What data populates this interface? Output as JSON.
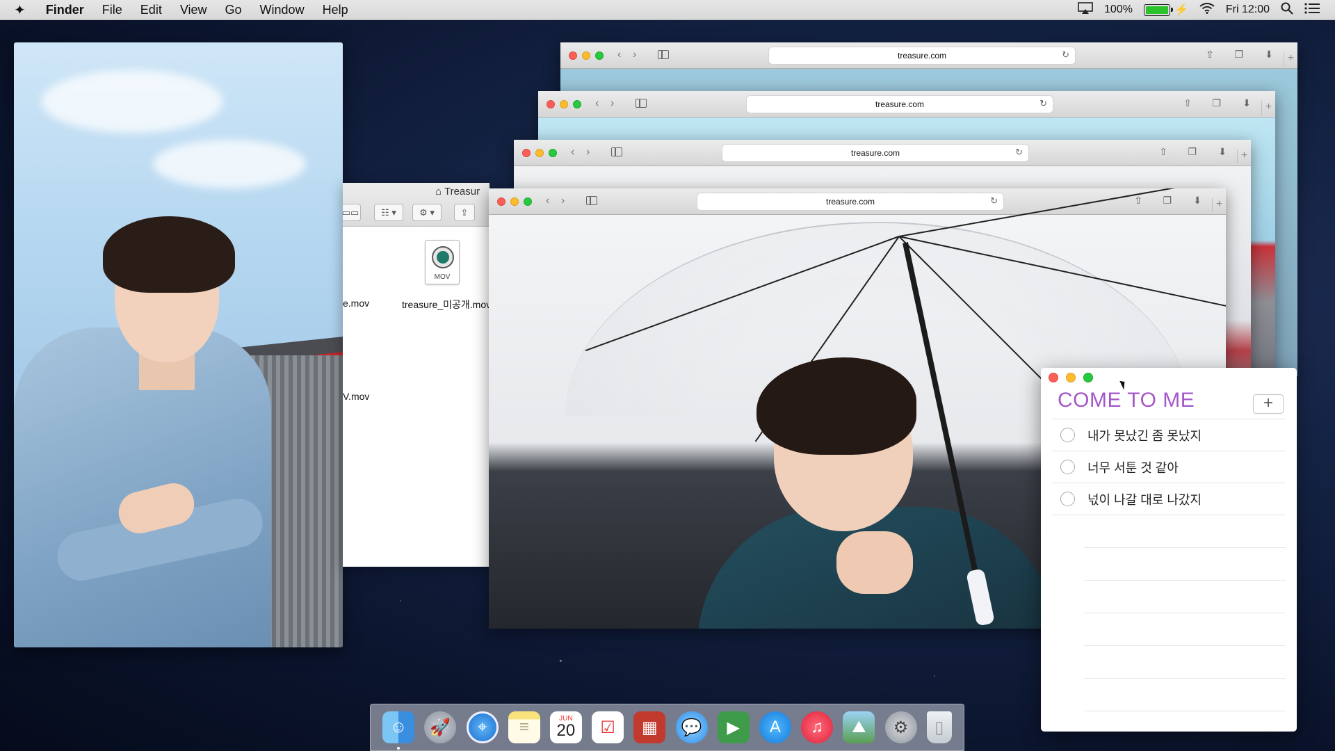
{
  "menubar": {
    "apple": "✦",
    "app": "Finder",
    "menus": [
      "File",
      "Edit",
      "View",
      "Go",
      "Window",
      "Help"
    ],
    "battery_pct": "100%",
    "battery_level": 1.0,
    "clock": "Fri 12:00"
  },
  "finder": {
    "title": "Treasur",
    "files": [
      {
        "name": "e.mov"
      },
      {
        "name": "treasure_미공개.mov",
        "icon_label": "MOV"
      },
      {
        "name": "V.mov"
      }
    ]
  },
  "browsers": [
    {
      "url": "treasure.com"
    },
    {
      "url": "treasure.com"
    },
    {
      "url": "treasure.com"
    },
    {
      "url": "treasure.com"
    }
  ],
  "reminders": {
    "title": "COME TO ME",
    "add": "+",
    "items": [
      {
        "text": "내가 못났긴 좀 못났지",
        "done": false
      },
      {
        "text": "너무 서툰 것 같아",
        "done": false
      },
      {
        "text": "넋이 나갈 대로 나갔지",
        "done": false
      }
    ],
    "title_color": "#a557c9"
  },
  "dock": {
    "calendar_month": "JUN",
    "calendar_day": "20",
    "apps": [
      "finder-icon",
      "launchpad-icon",
      "safari-icon",
      "notes-icon",
      "calendar-icon",
      "reminders-icon",
      "photo-booth-icon",
      "messages-icon",
      "facetime-icon",
      "app-store-icon",
      "music-icon",
      "photos-icon",
      "system-preferences-icon",
      "trash-icon"
    ]
  }
}
